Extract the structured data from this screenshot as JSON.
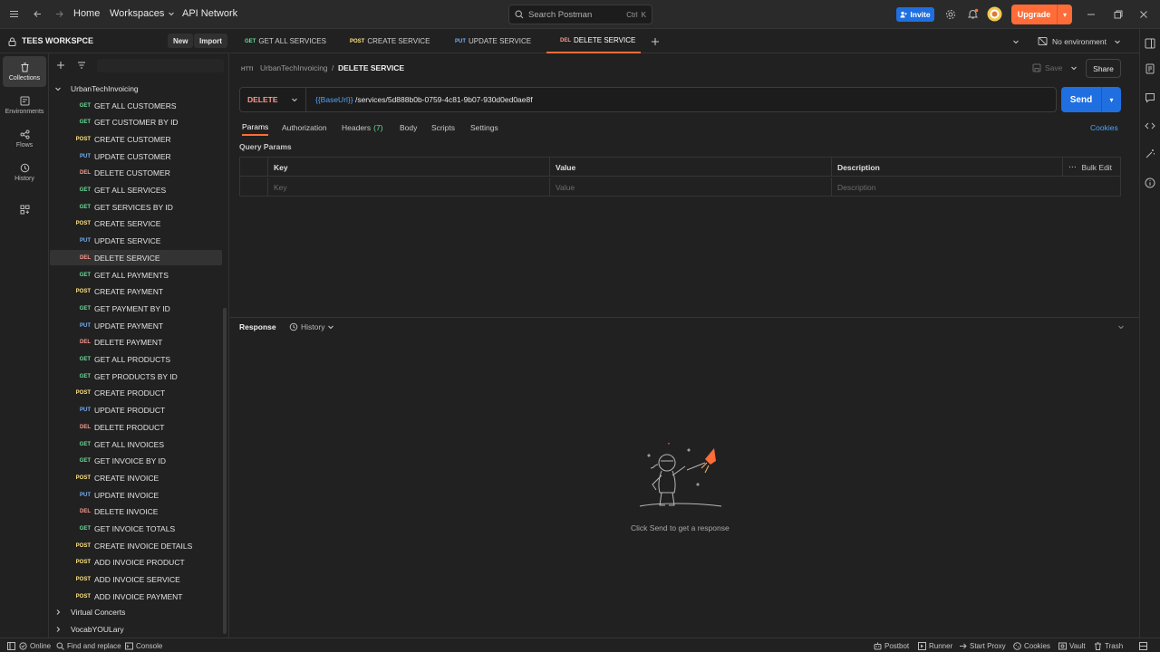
{
  "topbar": {
    "nav": [
      "Home",
      "Workspaces",
      "API Network"
    ],
    "search_placeholder": "Search Postman",
    "shortcut_ctrl": "Ctrl",
    "shortcut_key": "K",
    "invite_label": "Invite",
    "upgrade_label": "Upgrade"
  },
  "workspace": {
    "name": "TEES WORKSPCE",
    "new_label": "New",
    "import_label": "Import"
  },
  "rail": [
    {
      "label": "Collections"
    },
    {
      "label": "Environments"
    },
    {
      "label": "Flows"
    },
    {
      "label": "History"
    }
  ],
  "collections": {
    "root": "UrbanTechInvoicing",
    "items": [
      {
        "method": "GET",
        "name": "GET ALL CUSTOMERS"
      },
      {
        "method": "GET",
        "name": "GET CUSTOMER BY ID"
      },
      {
        "method": "POST",
        "name": "CREATE CUSTOMER"
      },
      {
        "method": "PUT",
        "name": "UPDATE CUSTOMER"
      },
      {
        "method": "DEL",
        "name": "DELETE CUSTOMER"
      },
      {
        "method": "GET",
        "name": "GET ALL SERVICES"
      },
      {
        "method": "GET",
        "name": "GET SERVICES BY ID"
      },
      {
        "method": "POST",
        "name": "CREATE SERVICE"
      },
      {
        "method": "PUT",
        "name": "UPDATE SERVICE"
      },
      {
        "method": "DEL",
        "name": "DELETE SERVICE"
      },
      {
        "method": "GET",
        "name": "GET ALL PAYMENTS"
      },
      {
        "method": "POST",
        "name": "CREATE PAYMENT"
      },
      {
        "method": "GET",
        "name": "GET PAYMENT BY ID"
      },
      {
        "method": "PUT",
        "name": "UPDATE PAYMENT"
      },
      {
        "method": "DEL",
        "name": "DELETE PAYMENT"
      },
      {
        "method": "GET",
        "name": "GET ALL PRODUCTS"
      },
      {
        "method": "GET",
        "name": "GET PRODUCTS BY ID"
      },
      {
        "method": "POST",
        "name": "CREATE PRODUCT"
      },
      {
        "method": "PUT",
        "name": "UPDATE PRODUCT"
      },
      {
        "method": "DEL",
        "name": "DELETE PRODUCT"
      },
      {
        "method": "GET",
        "name": "GET ALL INVOICES"
      },
      {
        "method": "GET",
        "name": "GET INVOICE BY ID"
      },
      {
        "method": "POST",
        "name": "CREATE INVOICE"
      },
      {
        "method": "PUT",
        "name": "UPDATE INVOICE"
      },
      {
        "method": "DEL",
        "name": "DELETE INVOICE"
      },
      {
        "method": "GET",
        "name": "GET INVOICE TOTALS"
      },
      {
        "method": "POST",
        "name": "CREATE INVOICE DETAILS"
      },
      {
        "method": "POST",
        "name": "ADD INVOICE PRODUCT"
      },
      {
        "method": "POST",
        "name": "ADD INVOICE SERVICE"
      },
      {
        "method": "POST",
        "name": "ADD INVOICE PAYMENT"
      }
    ],
    "active_item": "DELETE SERVICE",
    "other_collections": [
      "Virtual Concerts",
      "VocabYOULary"
    ]
  },
  "tabs": [
    {
      "method": "GET",
      "name": "GET ALL SERVICES"
    },
    {
      "method": "POST",
      "name": "CREATE SERVICE"
    },
    {
      "method": "PUT",
      "name": "UPDATE SERVICE"
    },
    {
      "method": "DEL",
      "name": "DELETE SERVICE"
    }
  ],
  "environment": "No environment",
  "request": {
    "breadcrumb_collection": "UrbanTechInvoicing",
    "breadcrumb_sep": "/",
    "name": "DELETE SERVICE",
    "save_label": "Save",
    "share_label": "Share",
    "method": "DELETE",
    "url_variable": "{{BaseUrl}}",
    "url_path": " /services/5d888b0b-0759-4c81-9b07-930d0ed0ae8f",
    "send_label": "Send"
  },
  "subtabs": {
    "params": "Params",
    "authorization": "Authorization",
    "headers": "Headers",
    "headers_count": "(7)",
    "body": "Body",
    "scripts": "Scripts",
    "settings": "Settings",
    "cookies": "Cookies"
  },
  "query_params": {
    "title": "Query Params",
    "headers": [
      "Key",
      "Value",
      "Description"
    ],
    "bulk_edit": "Bulk Edit",
    "placeholders": [
      "Key",
      "Value",
      "Description"
    ]
  },
  "response": {
    "label": "Response",
    "history_label": "History",
    "empty_message": "Click Send to get a response"
  },
  "statusbar": {
    "online": "Online",
    "find_replace": "Find and replace",
    "console": "Console",
    "postbot": "Postbot",
    "runner": "Runner",
    "start_proxy": "Start Proxy",
    "cookies": "Cookies",
    "vault": "Vault",
    "trash": "Trash"
  },
  "colors": {
    "accent": "#ff6c37",
    "primary": "#1f6fe0",
    "get": "#6bdd9a",
    "post": "#ffe47e",
    "put": "#74aef6",
    "delete": "#f79a8e"
  }
}
